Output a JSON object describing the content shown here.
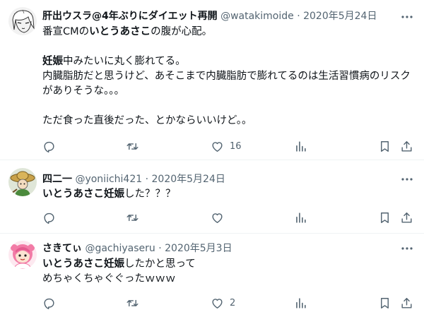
{
  "tweets": [
    {
      "display_name": "肝出ウスラ@4年ぶりにダイエット再開",
      "handle": "@watakimoide",
      "sep": "·",
      "date": "2020年5月24日",
      "body": [
        {
          "text": "番宣CMの",
          "bold": false
        },
        {
          "text": "いとうあさこ",
          "bold": true
        },
        {
          "text": "の腹が心配。\n\n",
          "bold": false
        },
        {
          "text": "妊娠",
          "bold": true
        },
        {
          "text": "中みたいに丸く膨れてる。\n内臓脂肪だと思うけど、あそこまで内臓脂肪で膨れてるのは生活習慣病のリスクがありそうな。。。\n\nただ食った直後だった、とかならいいけど。。",
          "bold": false
        }
      ],
      "likes": "16",
      "avatar_icon": "sketch-face-avatar-icon"
    },
    {
      "display_name": "四二一",
      "handle": "@yoniichi421",
      "sep": "·",
      "date": "2020年5月24日",
      "body": [
        {
          "text": "いとうあさこ",
          "bold": true
        },
        {
          "text": "妊娠",
          "bold": true
        },
        {
          "text": "した？？？",
          "bold": false
        }
      ],
      "likes": "",
      "avatar_icon": "straw-hat-character-avatar-icon"
    },
    {
      "display_name": "さきてぃ",
      "handle": "@gachiyaseru",
      "sep": "·",
      "date": "2020年5月3日",
      "body": [
        {
          "text": "いとうあさこ",
          "bold": true
        },
        {
          "text": "妊娠",
          "bold": true
        },
        {
          "text": "したかと思って\nめちゃくちゃぐぐったｗｗｗ",
          "bold": false
        }
      ],
      "likes": "2",
      "avatar_icon": "pink-hair-girl-avatar-icon"
    }
  ],
  "colors": {
    "text": "#0f1419",
    "secondary": "#536471",
    "divider": "#eff3f4",
    "avatar_pink": "#f27ba6",
    "avatar_green": "#4b8a3c",
    "avatar_hat": "#c9a24a"
  },
  "action_icons": [
    "reply-icon",
    "retweet-icon",
    "like-icon",
    "views-icon",
    "bookmark-icon",
    "share-icon"
  ]
}
